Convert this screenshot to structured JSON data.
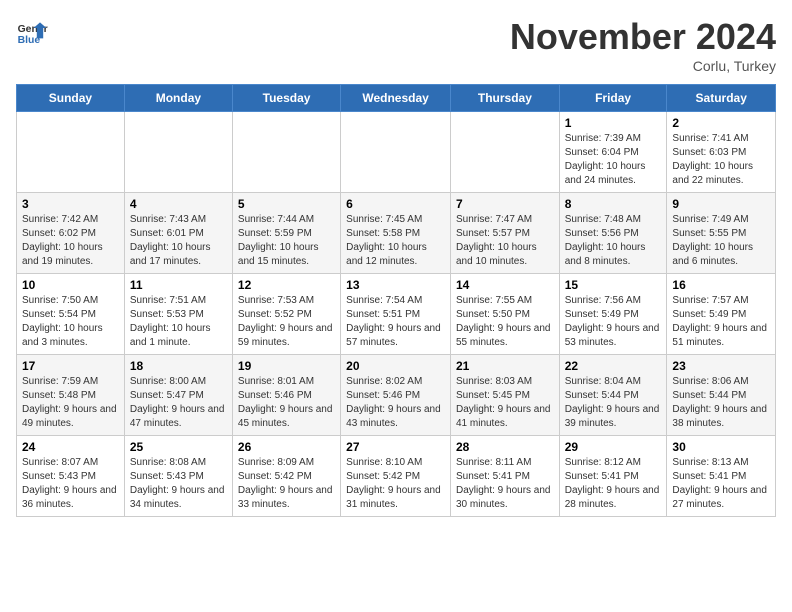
{
  "logo": {
    "line1": "General",
    "line2": "Blue"
  },
  "title": "November 2024",
  "location": "Corlu, Turkey",
  "days_of_week": [
    "Sunday",
    "Monday",
    "Tuesday",
    "Wednesday",
    "Thursday",
    "Friday",
    "Saturday"
  ],
  "weeks": [
    [
      {
        "day": "",
        "info": ""
      },
      {
        "day": "",
        "info": ""
      },
      {
        "day": "",
        "info": ""
      },
      {
        "day": "",
        "info": ""
      },
      {
        "day": "",
        "info": ""
      },
      {
        "day": "1",
        "info": "Sunrise: 7:39 AM\nSunset: 6:04 PM\nDaylight: 10 hours and 24 minutes."
      },
      {
        "day": "2",
        "info": "Sunrise: 7:41 AM\nSunset: 6:03 PM\nDaylight: 10 hours and 22 minutes."
      }
    ],
    [
      {
        "day": "3",
        "info": "Sunrise: 7:42 AM\nSunset: 6:02 PM\nDaylight: 10 hours and 19 minutes."
      },
      {
        "day": "4",
        "info": "Sunrise: 7:43 AM\nSunset: 6:01 PM\nDaylight: 10 hours and 17 minutes."
      },
      {
        "day": "5",
        "info": "Sunrise: 7:44 AM\nSunset: 5:59 PM\nDaylight: 10 hours and 15 minutes."
      },
      {
        "day": "6",
        "info": "Sunrise: 7:45 AM\nSunset: 5:58 PM\nDaylight: 10 hours and 12 minutes."
      },
      {
        "day": "7",
        "info": "Sunrise: 7:47 AM\nSunset: 5:57 PM\nDaylight: 10 hours and 10 minutes."
      },
      {
        "day": "8",
        "info": "Sunrise: 7:48 AM\nSunset: 5:56 PM\nDaylight: 10 hours and 8 minutes."
      },
      {
        "day": "9",
        "info": "Sunrise: 7:49 AM\nSunset: 5:55 PM\nDaylight: 10 hours and 6 minutes."
      }
    ],
    [
      {
        "day": "10",
        "info": "Sunrise: 7:50 AM\nSunset: 5:54 PM\nDaylight: 10 hours and 3 minutes."
      },
      {
        "day": "11",
        "info": "Sunrise: 7:51 AM\nSunset: 5:53 PM\nDaylight: 10 hours and 1 minute."
      },
      {
        "day": "12",
        "info": "Sunrise: 7:53 AM\nSunset: 5:52 PM\nDaylight: 9 hours and 59 minutes."
      },
      {
        "day": "13",
        "info": "Sunrise: 7:54 AM\nSunset: 5:51 PM\nDaylight: 9 hours and 57 minutes."
      },
      {
        "day": "14",
        "info": "Sunrise: 7:55 AM\nSunset: 5:50 PM\nDaylight: 9 hours and 55 minutes."
      },
      {
        "day": "15",
        "info": "Sunrise: 7:56 AM\nSunset: 5:49 PM\nDaylight: 9 hours and 53 minutes."
      },
      {
        "day": "16",
        "info": "Sunrise: 7:57 AM\nSunset: 5:49 PM\nDaylight: 9 hours and 51 minutes."
      }
    ],
    [
      {
        "day": "17",
        "info": "Sunrise: 7:59 AM\nSunset: 5:48 PM\nDaylight: 9 hours and 49 minutes."
      },
      {
        "day": "18",
        "info": "Sunrise: 8:00 AM\nSunset: 5:47 PM\nDaylight: 9 hours and 47 minutes."
      },
      {
        "day": "19",
        "info": "Sunrise: 8:01 AM\nSunset: 5:46 PM\nDaylight: 9 hours and 45 minutes."
      },
      {
        "day": "20",
        "info": "Sunrise: 8:02 AM\nSunset: 5:46 PM\nDaylight: 9 hours and 43 minutes."
      },
      {
        "day": "21",
        "info": "Sunrise: 8:03 AM\nSunset: 5:45 PM\nDaylight: 9 hours and 41 minutes."
      },
      {
        "day": "22",
        "info": "Sunrise: 8:04 AM\nSunset: 5:44 PM\nDaylight: 9 hours and 39 minutes."
      },
      {
        "day": "23",
        "info": "Sunrise: 8:06 AM\nSunset: 5:44 PM\nDaylight: 9 hours and 38 minutes."
      }
    ],
    [
      {
        "day": "24",
        "info": "Sunrise: 8:07 AM\nSunset: 5:43 PM\nDaylight: 9 hours and 36 minutes."
      },
      {
        "day": "25",
        "info": "Sunrise: 8:08 AM\nSunset: 5:43 PM\nDaylight: 9 hours and 34 minutes."
      },
      {
        "day": "26",
        "info": "Sunrise: 8:09 AM\nSunset: 5:42 PM\nDaylight: 9 hours and 33 minutes."
      },
      {
        "day": "27",
        "info": "Sunrise: 8:10 AM\nSunset: 5:42 PM\nDaylight: 9 hours and 31 minutes."
      },
      {
        "day": "28",
        "info": "Sunrise: 8:11 AM\nSunset: 5:41 PM\nDaylight: 9 hours and 30 minutes."
      },
      {
        "day": "29",
        "info": "Sunrise: 8:12 AM\nSunset: 5:41 PM\nDaylight: 9 hours and 28 minutes."
      },
      {
        "day": "30",
        "info": "Sunrise: 8:13 AM\nSunset: 5:41 PM\nDaylight: 9 hours and 27 minutes."
      }
    ]
  ]
}
